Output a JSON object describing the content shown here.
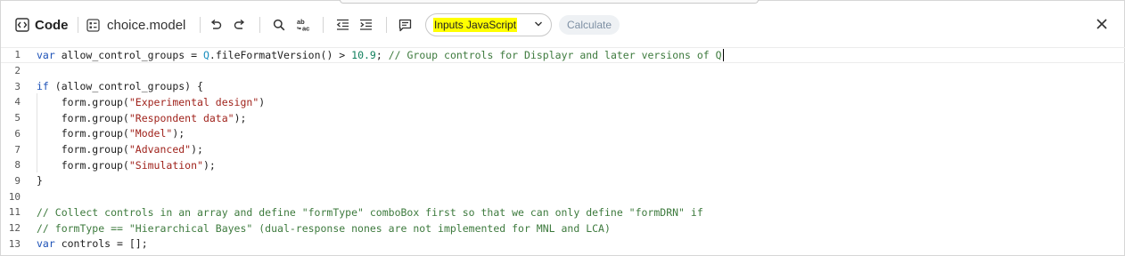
{
  "toolbar": {
    "code_label": "Code",
    "model_name": "choice.model",
    "inputs_select": "Inputs JavaScript",
    "calculate_label": "Calculate"
  },
  "icons": [
    "code-icon",
    "model-file-icon",
    "undo-icon",
    "redo-icon",
    "search-icon",
    "replace-icon",
    "outdent-icon",
    "indent-icon",
    "comment-icon",
    "chevron-down-icon",
    "close-icon"
  ],
  "editor": {
    "line_numbers": [
      "1",
      "2",
      "3",
      "4",
      "5",
      "6",
      "7",
      "8",
      "9",
      "10",
      "11",
      "12",
      "13"
    ],
    "lines": {
      "l1": {
        "kw": "var",
        "a": " allow_control_groups = ",
        "q": "Q",
        "b": ".fileFormatVersion() > ",
        "num": "10.9",
        "c": "; ",
        "com": "// Group controls for Displayr and later versions of Q"
      },
      "l3": {
        "kw": "if",
        "a": " (allow_control_groups) {"
      },
      "l4": {
        "a": "    form.group(",
        "str": "\"Experimental design\"",
        "b": ")"
      },
      "l5": {
        "a": "    form.group(",
        "str": "\"Respondent data\"",
        "b": ");"
      },
      "l6": {
        "a": "    form.group(",
        "str": "\"Model\"",
        "b": ");"
      },
      "l7": {
        "a": "    form.group(",
        "str": "\"Advanced\"",
        "b": ");"
      },
      "l8": {
        "a": "    form.group(",
        "str": "\"Simulation\"",
        "b": ");"
      },
      "l9": {
        "a": "}"
      },
      "l11": {
        "com": "// Collect controls in an array and define \"formType\" comboBox first so that we can only define \"formDRN\" if"
      },
      "l12": {
        "com": "// formType == \"Hierarchical Bayes\" (dual-response nones are not implemented for MNL and LCA)"
      },
      "l13": {
        "kw": "var",
        "a": " controls = [];"
      }
    }
  }
}
